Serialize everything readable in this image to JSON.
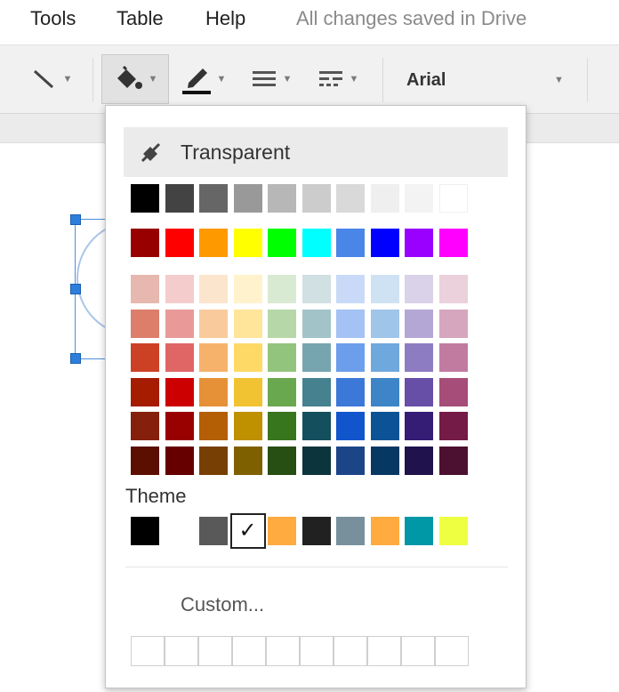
{
  "menubar": {
    "items": [
      "Tools",
      "Table",
      "Help"
    ],
    "status": "All changes saved in Drive"
  },
  "toolbar": {
    "line_icon": "line-icon",
    "fill_icon": "paint-bucket-icon",
    "border_color_icon": "pencil-icon",
    "border_weight_icon": "border-weight-icon",
    "border_dash_icon": "border-dash-icon",
    "font": "Arial"
  },
  "popup": {
    "transparent_label": "Transparent",
    "transparent_icon": "transparent-fill-icon",
    "grays": [
      "#000000",
      "#434343",
      "#666666",
      "#999999",
      "#b7b7b7",
      "#cccccc",
      "#d9d9d9",
      "#efefef",
      "#f3f3f3",
      "#ffffff"
    ],
    "brights": [
      "#980000",
      "#ff0000",
      "#ff9900",
      "#ffff00",
      "#00ff00",
      "#00ffff",
      "#4a86e8",
      "#0000ff",
      "#9900ff",
      "#ff00ff"
    ],
    "shades": [
      [
        "#e6b8af",
        "#f4cccc",
        "#fce5cd",
        "#fff2cc",
        "#d9ead3",
        "#d0e0e3",
        "#c9daf8",
        "#cfe2f3",
        "#d9d2e9",
        "#ead1dc"
      ],
      [
        "#dd7e6b",
        "#ea9999",
        "#f9cb9c",
        "#ffe599",
        "#b6d7a8",
        "#a2c4c9",
        "#a4c2f4",
        "#9fc5e8",
        "#b4a7d6",
        "#d5a6bd"
      ],
      [
        "#cc4125",
        "#e06666",
        "#f6b26b",
        "#ffd966",
        "#93c47d",
        "#76a5af",
        "#6d9eeb",
        "#6fa8dc",
        "#8e7cc3",
        "#c27ba0"
      ],
      [
        "#a61c00",
        "#cc0000",
        "#e69138",
        "#f1c232",
        "#6aa84f",
        "#45818e",
        "#3c78d8",
        "#3d85c6",
        "#674ea7",
        "#a64d79"
      ],
      [
        "#85200c",
        "#990000",
        "#b45f06",
        "#bf9000",
        "#38761d",
        "#134f5c",
        "#1155cc",
        "#0b5394",
        "#351c75",
        "#741b47"
      ],
      [
        "#5b0f00",
        "#660000",
        "#783f04",
        "#7f6000",
        "#274e13",
        "#0c343d",
        "#1c4587",
        "#073763",
        "#20124d",
        "#4c1130"
      ]
    ],
    "theme_label": "Theme",
    "theme_colors": [
      "#000000",
      "#ffffff",
      "#595959",
      "#ffffff",
      "#ffab40",
      "#212121",
      "#78909c",
      "#ffab40",
      "#0097a7",
      "#eeff41"
    ],
    "theme_selected_index": 3,
    "theme_check": "✓",
    "custom_label": "Custom...",
    "custom_slot_count": 10
  }
}
